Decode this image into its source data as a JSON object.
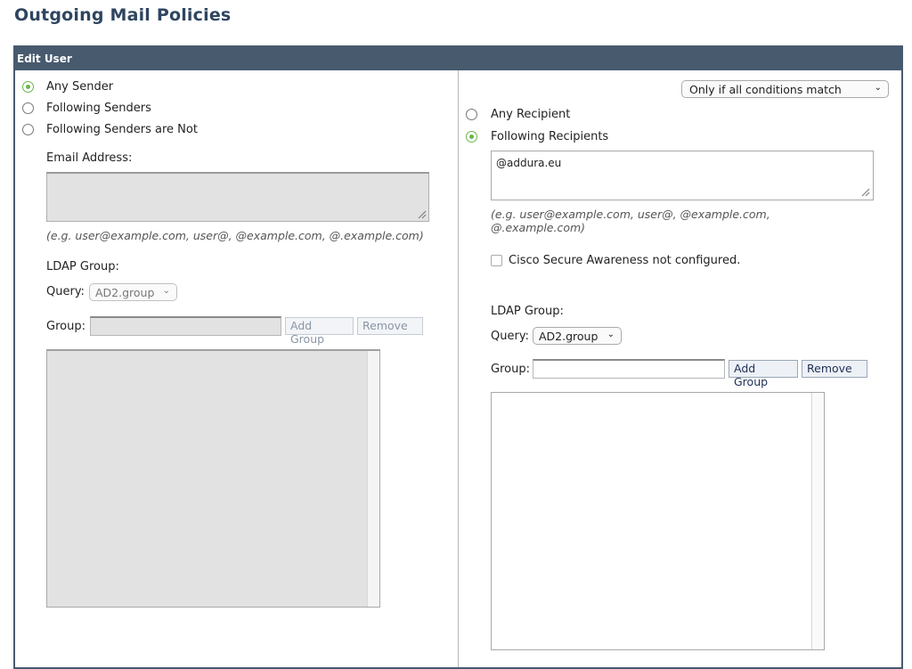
{
  "page_title": "Outgoing Mail Policies",
  "panel": {
    "header": "Edit User"
  },
  "sender": {
    "options": [
      "Any Sender",
      "Following Senders",
      "Following Senders are Not"
    ],
    "selected": "Any Sender",
    "email_label": "Email Address:",
    "email_value": "",
    "hint": "(e.g. user@example.com, user@, @example.com, @.example.com)",
    "ldap_label": "LDAP Group:",
    "query_label": "Query:",
    "query_value": "AD2.group",
    "group_label": "Group:",
    "group_value": "",
    "add_group_label": "Add Group",
    "remove_label": "Remove",
    "disabled": true
  },
  "recipient": {
    "match_mode": "Only if all conditions match",
    "options": [
      "Any Recipient",
      "Following Recipients"
    ],
    "selected": "Following Recipients",
    "email_value": "@addura.eu",
    "hint_line1": "(e.g. user@example.com, user@, @example.com,",
    "hint_line2": "@.example.com)",
    "awareness_label": "Cisco Secure Awareness not configured.",
    "awareness_checked": false,
    "ldap_label": "LDAP Group:",
    "query_label": "Query:",
    "query_value": "AD2.group",
    "group_label": "Group:",
    "group_value": "",
    "add_group_label": "Add Group",
    "remove_label": "Remove"
  },
  "colors": {
    "header_bg": "#485a6e",
    "title": "#2f4560",
    "radio_selected": "#6bb54a",
    "disabled_fill": "#e2e2e2"
  }
}
